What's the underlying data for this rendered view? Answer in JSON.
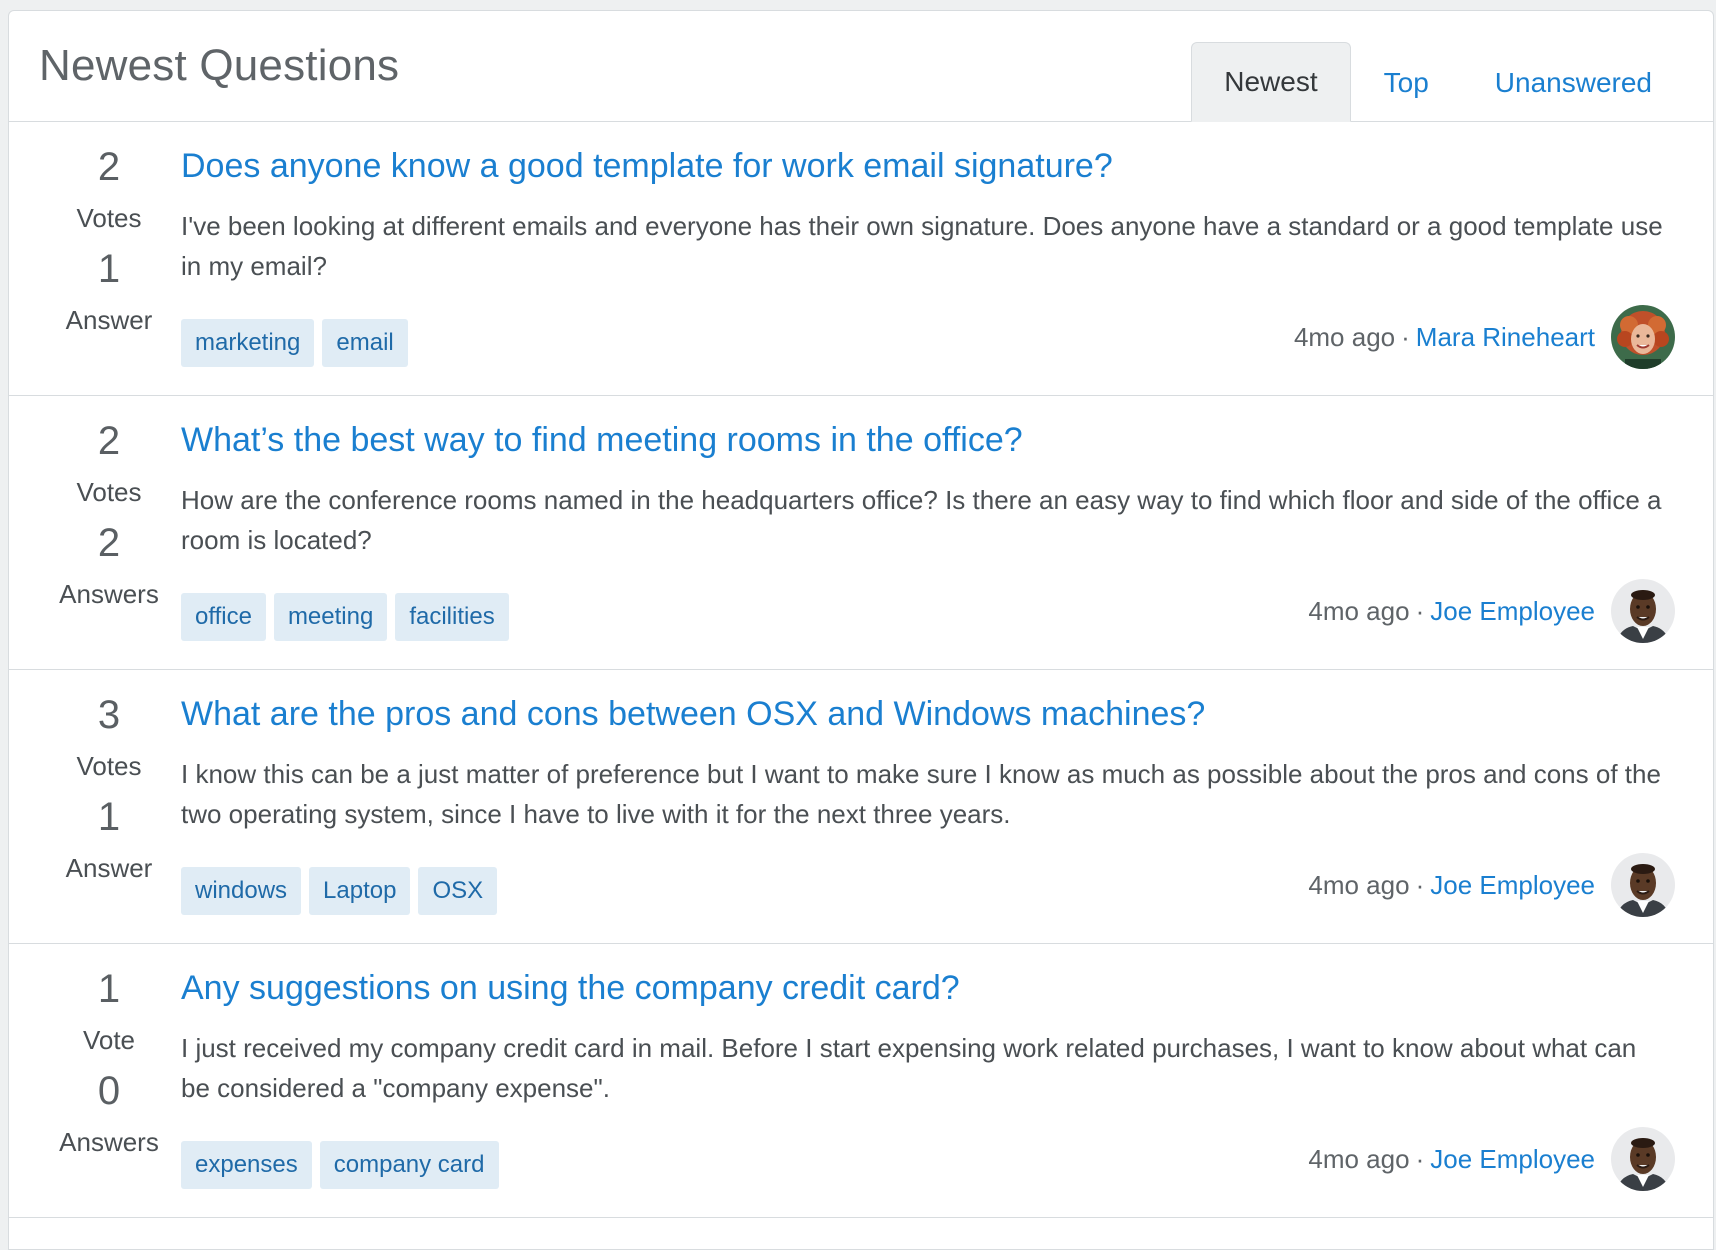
{
  "header": {
    "title": "Newest Questions",
    "tabs": [
      {
        "label": "Newest",
        "active": true
      },
      {
        "label": "Top",
        "active": false
      },
      {
        "label": "Unanswered",
        "active": false
      }
    ]
  },
  "questions": [
    {
      "votes": "2",
      "votes_label": "Votes",
      "answers": "1",
      "answers_label": "Answer",
      "title": "Does anyone know a good template for work email signature?",
      "excerpt": "I've been looking at different emails and everyone has their own signature. Does anyone have a standard or a good template use in my email?",
      "tags": [
        "marketing",
        "email"
      ],
      "time": "4mo ago",
      "separator": "·",
      "author": "Mara Rineheart",
      "avatar": "avatar-female"
    },
    {
      "votes": "2",
      "votes_label": "Votes",
      "answers": "2",
      "answers_label": "Answers",
      "title": "What’s the best way to find meeting rooms in the office?",
      "excerpt": "How are the conference rooms named in the headquarters office? Is there an easy way to find which floor and side of the office a room is located?",
      "tags": [
        "office",
        "meeting",
        "facilities"
      ],
      "time": "4mo ago",
      "separator": "·",
      "author": "Joe Employee",
      "avatar": "avatar-male"
    },
    {
      "votes": "3",
      "votes_label": "Votes",
      "answers": "1",
      "answers_label": "Answer",
      "title": "What are the pros and cons between OSX and Windows machines?",
      "excerpt": "I know this can be a just matter of preference but I want to make sure I know as much as possible about the pros and cons of the two operating system, since I have to live with it for the next three years.",
      "tags": [
        "windows",
        "Laptop",
        "OSX"
      ],
      "time": "4mo ago",
      "separator": "·",
      "author": "Joe Employee",
      "avatar": "avatar-male"
    },
    {
      "votes": "1",
      "votes_label": "Vote",
      "answers": "0",
      "answers_label": "Answers",
      "title": "Any suggestions on using the company credit card?",
      "excerpt": "I just received my company credit card in mail. Before I start expensing work related purchases, I want to know about what can be considered a \"company expense\".",
      "tags": [
        "expenses",
        "company card"
      ],
      "time": "4mo ago",
      "separator": "·",
      "author": "Joe Employee",
      "avatar": "avatar-male"
    }
  ],
  "colors": {
    "link": "#1a7fd0",
    "tag_bg": "#e0ecf5",
    "tag_text": "#1f6aa8",
    "text": "#4a4f53",
    "border": "#d8dcdf"
  }
}
